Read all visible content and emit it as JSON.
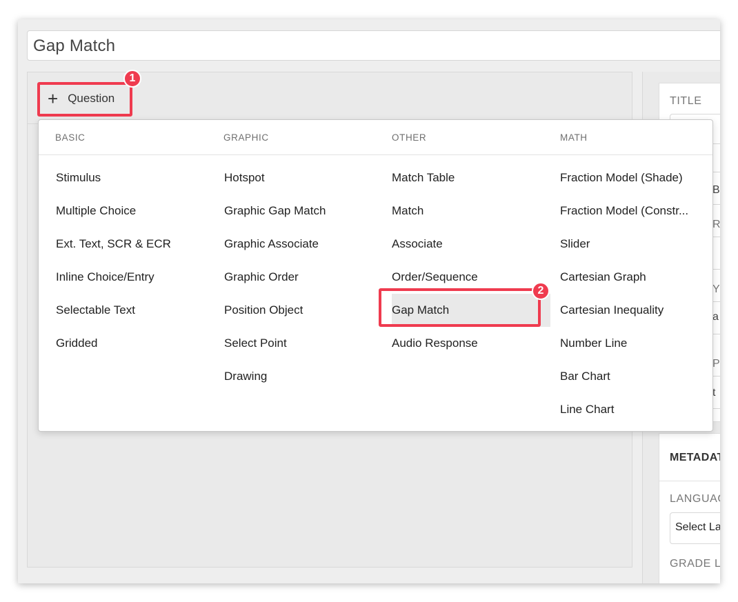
{
  "item_title": "Gap Match",
  "add_question": {
    "icon": "plus-icon",
    "label": "Question"
  },
  "badges": {
    "first": "1",
    "second": "2"
  },
  "menu": {
    "columns": [
      {
        "heading": "BASIC",
        "items": [
          "Stimulus",
          "Multiple Choice",
          "Ext. Text, SCR & ECR",
          "Inline Choice/Entry",
          "Selectable Text",
          "Gridded"
        ]
      },
      {
        "heading": "GRAPHIC",
        "items": [
          "Hotspot",
          "Graphic Gap Match",
          "Graphic Associate",
          "Graphic Order",
          "Position Object",
          "Select Point",
          "Drawing"
        ]
      },
      {
        "heading": "OTHER",
        "items": [
          "Match Table",
          "Match",
          "Associate",
          "Order/Sequence",
          "Gap Match",
          "Audio Response"
        ]
      },
      {
        "heading": "MATH",
        "items": [
          "Fraction Model (Shade)",
          "Fraction Model (Constr...",
          "Slider",
          "Cartesian Graph",
          "Cartesian Inequality",
          "Number Line",
          "Bar Chart",
          "Line Chart"
        ]
      }
    ],
    "selected": {
      "column": 2,
      "item": 4
    }
  },
  "right_panel": {
    "title_label": "TITLE",
    "peek_chars": [
      "B",
      "R",
      "Y",
      "a",
      "P",
      "t"
    ],
    "metadata_label": "METADAT",
    "language_label": "LANGUAG",
    "language_select": "Select La",
    "grade_label": "GRADE L"
  },
  "colors": {
    "highlight": "#ef3b4f",
    "selected_bg": "#e9e9e9"
  }
}
